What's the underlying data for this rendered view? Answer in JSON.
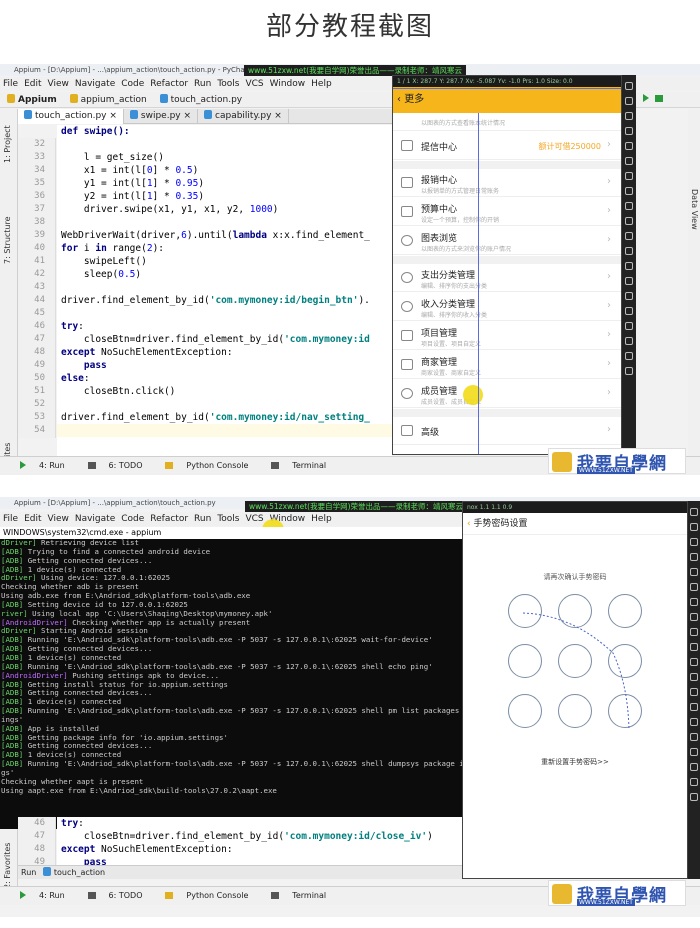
{
  "page_title": "部分教程截图",
  "top": {
    "window_title": "Appium - [D:\\Appium] - ...\\appium_action\\touch_action.py - PyCharm Com",
    "banner": "www.51zxw.net(我要自学网)荣誉出品——录制老师：靖风寒云",
    "menu": [
      "File",
      "Edit",
      "View",
      "Navigate",
      "Code",
      "Refactor",
      "Run",
      "Tools",
      "VCS",
      "Window",
      "Help"
    ],
    "breadcrumbs": [
      "Appium",
      "appium_action",
      "touch_action.py"
    ],
    "tabs": [
      "touch_action.py",
      "swipe.py",
      "capability.py"
    ],
    "side_labels": [
      "1: Project",
      "7: Structure",
      "2: Favorites"
    ],
    "right_label": "Data View",
    "line_numbers": [
      "32",
      "33",
      "34",
      "35",
      "36",
      "37",
      "38",
      "39",
      "40",
      "41",
      "42",
      "43",
      "44",
      "45",
      "46",
      "47",
      "48",
      "49",
      "50",
      "51",
      "52",
      "53",
      "54"
    ],
    "code_partial_top": "def swipe():",
    "code": {
      "l33": "l = get_size()",
      "l34_a": "x1 = int(l[",
      "l34_n": "0",
      "l34_b": "] * ",
      "l34_m": "0.5",
      "l34_c": ")",
      "l35_a": "y1 = int(l[",
      "l35_n": "1",
      "l35_b": "] * ",
      "l35_m": "0.95",
      "l35_c": ")",
      "l36_a": "y2 = int(l[",
      "l36_n": "1",
      "l36_b": "] * ",
      "l36_m": "0.35",
      "l36_c": ")",
      "l37_a": "driver.swipe(x1, y1, x1, y2, ",
      "l37_n": "1000",
      "l37_c": ")",
      "l39_a": "WebDriverWait(driver,",
      "l39_n": "6",
      "l39_b": ").until(",
      "l39_k": "lambda",
      "l39_c": " x:x.find_element_",
      "l40_k1": "for",
      "l40_a": " i ",
      "l40_k2": "in",
      "l40_b": " range(",
      "l40_n": "2",
      "l40_c": "):",
      "l41": "swipeLeft()",
      "l42_a": "sleep(",
      "l42_n": "0.5",
      "l42_c": ")",
      "l44_a": "driver.find_element_by_id(",
      "l44_s": "'com.mymoney:id/begin_btn'",
      "l44_c": ").",
      "l46_k": "try",
      "l46_c": ":",
      "l47_a": "closeBtn=driver.find_element_by_id(",
      "l47_s": "'com.mymoney:id",
      "l48_k": "except",
      "l48_c": " NoSuchElementException:",
      "l49_k": "pass",
      "l50_k": "else",
      "l50_c": ":",
      "l51": "closeBtn.click()",
      "l53_a": "driver.find_element_by_id(",
      "l53_s": "'com.mymoney:id/nav_setting_"
    },
    "tool_windows": [
      "4: Run",
      "6: TODO",
      "Python Console",
      "Terminal"
    ],
    "emulator": {
      "statusbar": "1 / 1    X: 287.7    Y: 287.7    Xv: -5.087    Yv: -1.0    Prs: 1.0    Size: 0.0",
      "header": "更多",
      "items": [
        {
          "title": "",
          "sub": "以图表的方式查看账本统计情况"
        },
        {
          "title": "提信中心",
          "sub": "",
          "badge": "额计可借250000"
        },
        {
          "title": "报销中心",
          "sub": "以报销单的方式管理日常账务"
        },
        {
          "title": "预算中心",
          "sub": "设定一个预算，控制你的开销"
        },
        {
          "title": "图表浏览",
          "sub": "以图表的方式来浏览你的账户情况"
        },
        {
          "title": "支出分类管理",
          "sub": "编辑、排序你的支出分类"
        },
        {
          "title": "收入分类管理",
          "sub": "编辑、排序你的收入分类"
        },
        {
          "title": "项目管理",
          "sub": "项目设置、项目自定义"
        },
        {
          "title": "商家管理",
          "sub": "商家设置、商家自定义"
        },
        {
          "title": "成员管理",
          "sub": "成员设置、成员自定义"
        },
        {
          "title": "高级",
          "sub": ""
        }
      ]
    }
  },
  "bottom": {
    "window_title": "Appium - [D:\\Appium] - ...\\appium_action\\touch_action.py",
    "banner": "www.51zxw.net(我要自学网)荣誉出品——录制老师：靖风寒云",
    "menu": [
      "File",
      "Edit",
      "View",
      "Navigate",
      "Code",
      "Refactor",
      "Run",
      "Tools",
      "VCS",
      "Window",
      "Help"
    ],
    "cmd_title": "WINDOWS\\system32\\cmd.exe - appium",
    "cmd_lines": [
      {
        "tag": "dDriver]",
        "text": " Retrieving device list"
      },
      {
        "tag": "[ADB]",
        "text": " Trying to find a connected android device"
      },
      {
        "tag": "[ADB]",
        "text": " Getting connected devices..."
      },
      {
        "tag": "[ADB]",
        "text": " 1 device(s) connected"
      },
      {
        "tag": "dDriver]",
        "text": " Using device: 127.0.0.1:62025"
      },
      {
        "tag": "",
        "text": "Checking whether adb is present"
      },
      {
        "tag": "",
        "text": "Using adb.exe from E:\\Andriod_sdk\\platform-tools\\adb.exe"
      },
      {
        "tag": "[ADB]",
        "text": " Setting device id to 127.0.0.1:62025"
      },
      {
        "tag": "river]",
        "text": " Using local app 'C:\\Users\\Shaqing\\Desktop\\mymoney.apk'"
      },
      {
        "tag": "[AndroidDriver]",
        "text": " Checking whether app is actually present"
      },
      {
        "tag": "dDriver]",
        "text": " Starting Android session"
      },
      {
        "tag": "[ADB]",
        "text": " Running 'E:\\Andriod_sdk\\platform-tools\\adb.exe -P 5037 -s 127.0.0.1\\:62025 wait-for-device'"
      },
      {
        "tag": "[ADB]",
        "text": " Getting connected devices..."
      },
      {
        "tag": "[ADB]",
        "text": " 1 device(s) connected"
      },
      {
        "tag": "[ADB]",
        "text": " Running 'E:\\Andriod_sdk\\platform-tools\\adb.exe -P 5037 -s 127.0.0.1\\:62025 shell echo ping'"
      },
      {
        "tag": "[AndroidDriver]",
        "text": " Pushing settings apk to device..."
      },
      {
        "tag": "[ADB]",
        "text": " Getting install status for io.appium.settings"
      },
      {
        "tag": "[ADB]",
        "text": " Getting connected devices..."
      },
      {
        "tag": "[ADB]",
        "text": " 1 device(s) connected"
      },
      {
        "tag": "[ADB]",
        "text": " Running 'E:\\Andriod_sdk\\platform-tools\\adb.exe -P 5037 -s 127.0.0.1\\:62025 shell pm list packages"
      },
      {
        "tag": "",
        "text": "ings'"
      },
      {
        "tag": "[ADB]",
        "text": " App is installed"
      },
      {
        "tag": "[ADB]",
        "text": " Getting package info for 'io.appium.settings'"
      },
      {
        "tag": "[ADB]",
        "text": " Getting connected devices..."
      },
      {
        "tag": "[ADB]",
        "text": " 1 device(s) connected"
      },
      {
        "tag": "[ADB]",
        "text": " Running 'E:\\Andriod_sdk\\platform-tools\\adb.exe -P 5037 -s 127.0.0.1\\:62025 shell dumpsys package i"
      },
      {
        "tag": "",
        "text": "gs'"
      },
      {
        "tag": "",
        "text": "Checking whether aapt is present"
      },
      {
        "tag": "",
        "text": "Using aapt.exe from E:\\Andriod_sdk\\build-tools\\27.0.2\\aapt.exe"
      }
    ],
    "line_numbers": [
      "46",
      "47",
      "48",
      "49"
    ],
    "code": {
      "l46_k": "try",
      "l46_c": ":",
      "l47_a": "closeBtn=driver.find_element_by_id(",
      "l47_s": "'com.mymoney:id/close_iv'",
      "l47_c": ")",
      "l48_k": "except",
      "l48_c": " NoSuchElementException:",
      "l49_k": "pass"
    },
    "run_tab": "touch_action",
    "run_label": "Run",
    "side_labels": [
      "2: Favorites"
    ],
    "tool_windows": [
      "4: Run",
      "6: TODO",
      "Python Console",
      "Terminal"
    ],
    "emulator": {
      "statusbar": "nox  1.1 1.1 0.9 ",
      "header": "手势密码设置",
      "prompt": "请再次确认手势密码",
      "reset": "重新设置手势密码>>"
    }
  },
  "logo": {
    "text": "我要自學網",
    "url": "WWW.51ZXW.NET"
  }
}
